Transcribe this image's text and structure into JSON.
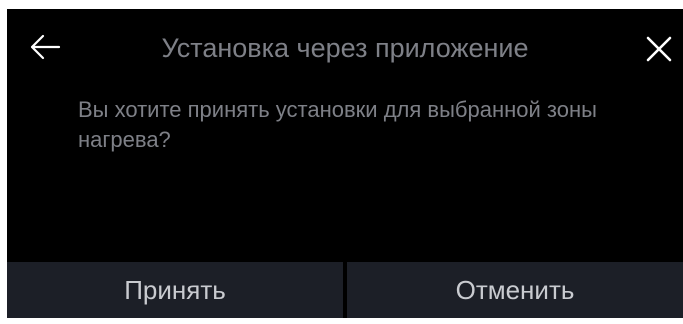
{
  "dialog": {
    "title": "Установка через приложение",
    "message": "Вы хотите принять установки для выбранной зоны нагрева?",
    "back_icon": "arrow-left-icon",
    "close_icon": "close-icon"
  },
  "actions": {
    "accept_label": "Принять",
    "cancel_label": "Отменить"
  },
  "colors": {
    "background": "#000000",
    "text_muted": "#7e8087",
    "icon": "#ffffff",
    "button_bg": "#1c1f27",
    "button_text": "#c9cbd0"
  }
}
